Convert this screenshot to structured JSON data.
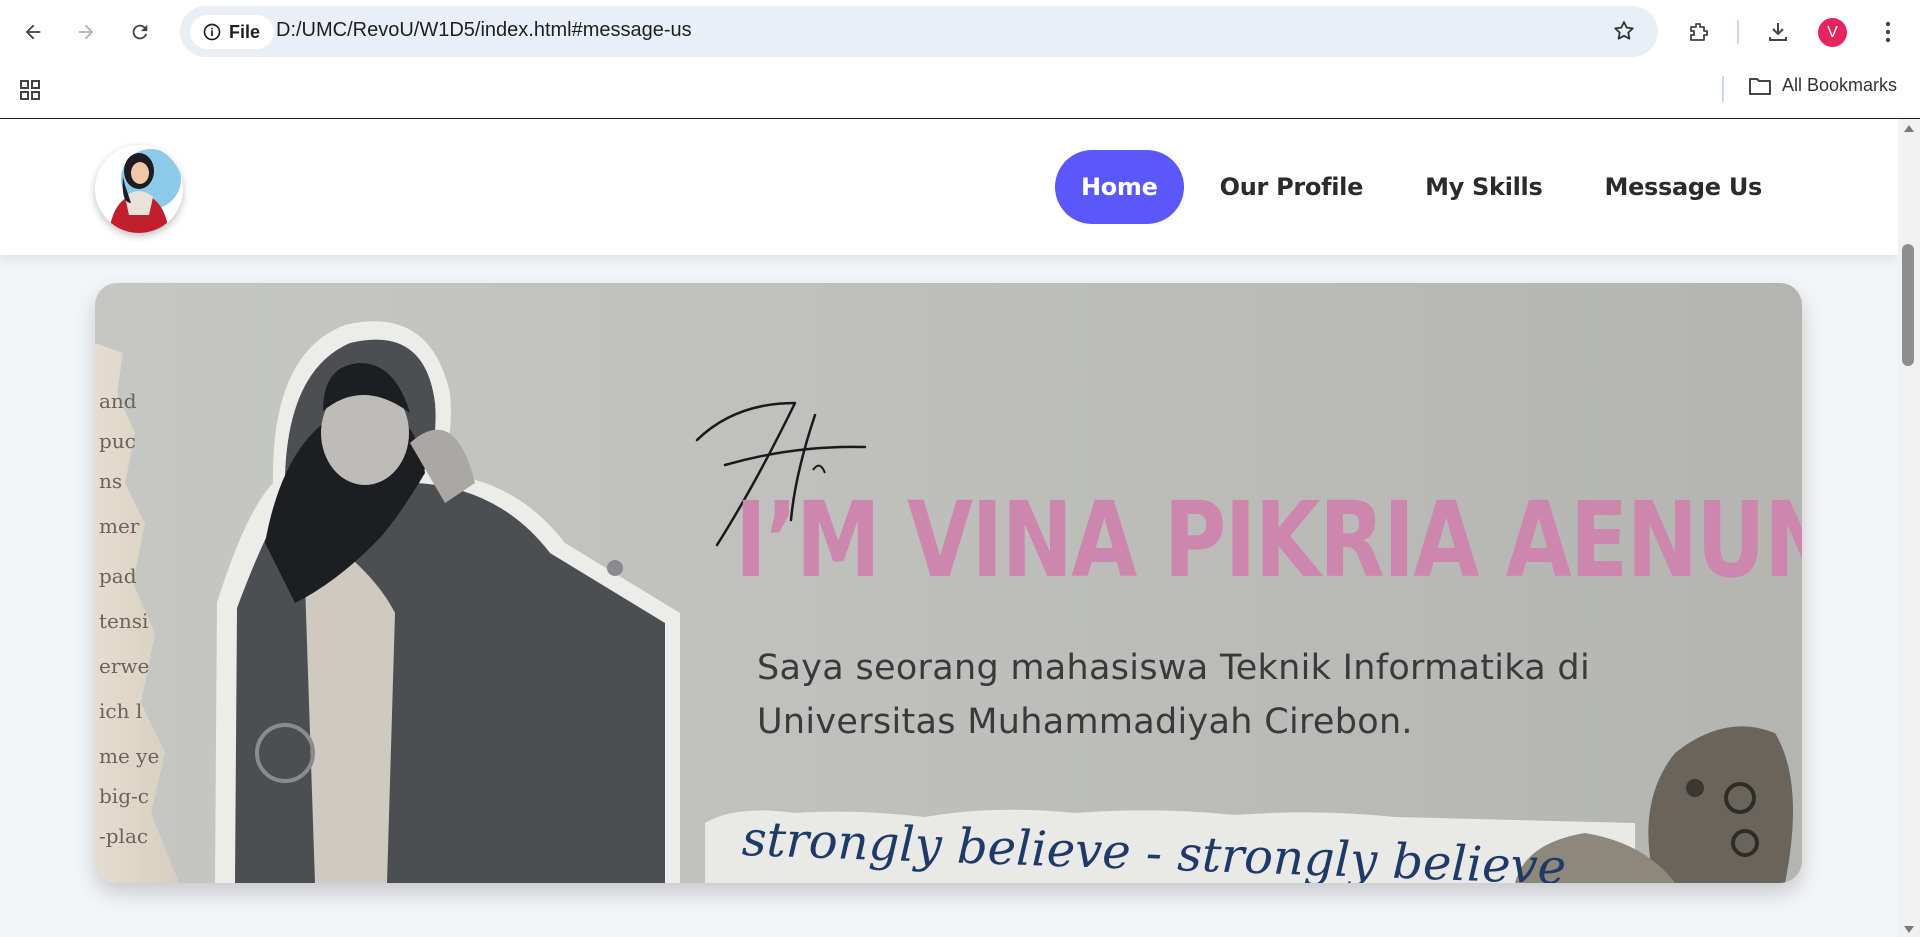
{
  "browser": {
    "site_info_label": "File",
    "url": "D:/UMC/RevoU/W1D5/index.html#message-us",
    "profile_initial": "V",
    "all_bookmarks_label": "All Bookmarks",
    "icons": [
      "back-icon",
      "forward-icon",
      "reload-icon",
      "info-icon",
      "star-icon",
      "extensions-icon",
      "download-icon",
      "more-icon",
      "apps-grid-icon",
      "folder-icon"
    ],
    "colors": {
      "omnibox": "#e9eef7",
      "profile": "#e6245e"
    }
  },
  "site": {
    "nav": [
      {
        "label": "Home",
        "active": true
      },
      {
        "label": "Our Profile",
        "active": false
      },
      {
        "label": "My Skills",
        "active": false
      },
      {
        "label": "Message Us",
        "active": false
      }
    ],
    "colors": {
      "accent": "#5a57fb",
      "name": "#cd86ac"
    }
  },
  "hero": {
    "greeting": "Hi",
    "name": "I’M VINA PIKRIA AENUN",
    "description": "Saya seorang mahasiswa Teknik Informatika di Universitas Muhammadiyah Cirebon.",
    "script_text": "strongly believe - strongly believe"
  }
}
